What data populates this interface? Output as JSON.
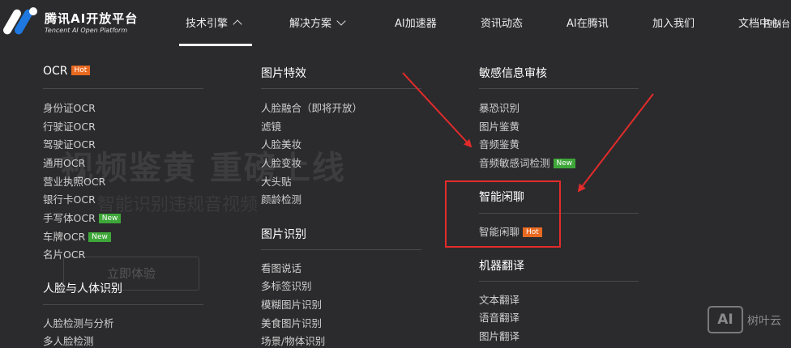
{
  "nav": {
    "brand_cn": "腾讯AI开放平台",
    "brand_en": "Tencent AI Open Platform",
    "items": [
      "技术引擎",
      "解决方案",
      "AI加速器",
      "资讯动态",
      "AI在腾讯",
      "加入我们",
      "文档中心",
      "控制台"
    ]
  },
  "background": {
    "headline": "视频鉴黄 重磅上线",
    "subline": "智能识别违规音视频",
    "button": "立即体验"
  },
  "menu": {
    "col1": {
      "heading1": "OCR",
      "heading1_tag": "Hot",
      "items": [
        "身份证OCR",
        "行驶证OCR",
        "驾驶证OCR",
        "通用OCR",
        "营业执照OCR",
        "银行卡OCR",
        "手写体OCR",
        "车牌OCR",
        "名片OCR"
      ],
      "tag_new": "New",
      "heading2": "人脸与人体识别",
      "items2": [
        "人脸检测与分析",
        "多人脸检测"
      ]
    },
    "col2": {
      "heading1": "图片特效",
      "items": [
        "人脸融合（即将开放）",
        "滤镜",
        "人脸美妆",
        "人脸变妆",
        "大头贴",
        "颜龄检测"
      ],
      "heading2": "图片识别",
      "items2": [
        "看图说话",
        "多标签识别",
        "模糊图片识别",
        "美食图片识别",
        "场景/物体识别"
      ]
    },
    "col3": {
      "heading1": "敏感信息审核",
      "items": [
        "暴恐识别",
        "图片鉴黄",
        "音频鉴黄",
        "音频敏感词检测"
      ],
      "tag_new": "New",
      "heading2": "智能闲聊",
      "chat_item": "智能闲聊",
      "tag_hot": "Hot",
      "heading3": "机器翻译",
      "items3": [
        "文本翻译",
        "语音翻译",
        "图片翻译"
      ]
    }
  },
  "watermark": {
    "logo": "AI",
    "text": "树叶云"
  },
  "colors": {
    "background": "#2b2b2d",
    "hot": "#e86a21",
    "new": "#3fa73a",
    "annotation": "#e32b2b"
  }
}
